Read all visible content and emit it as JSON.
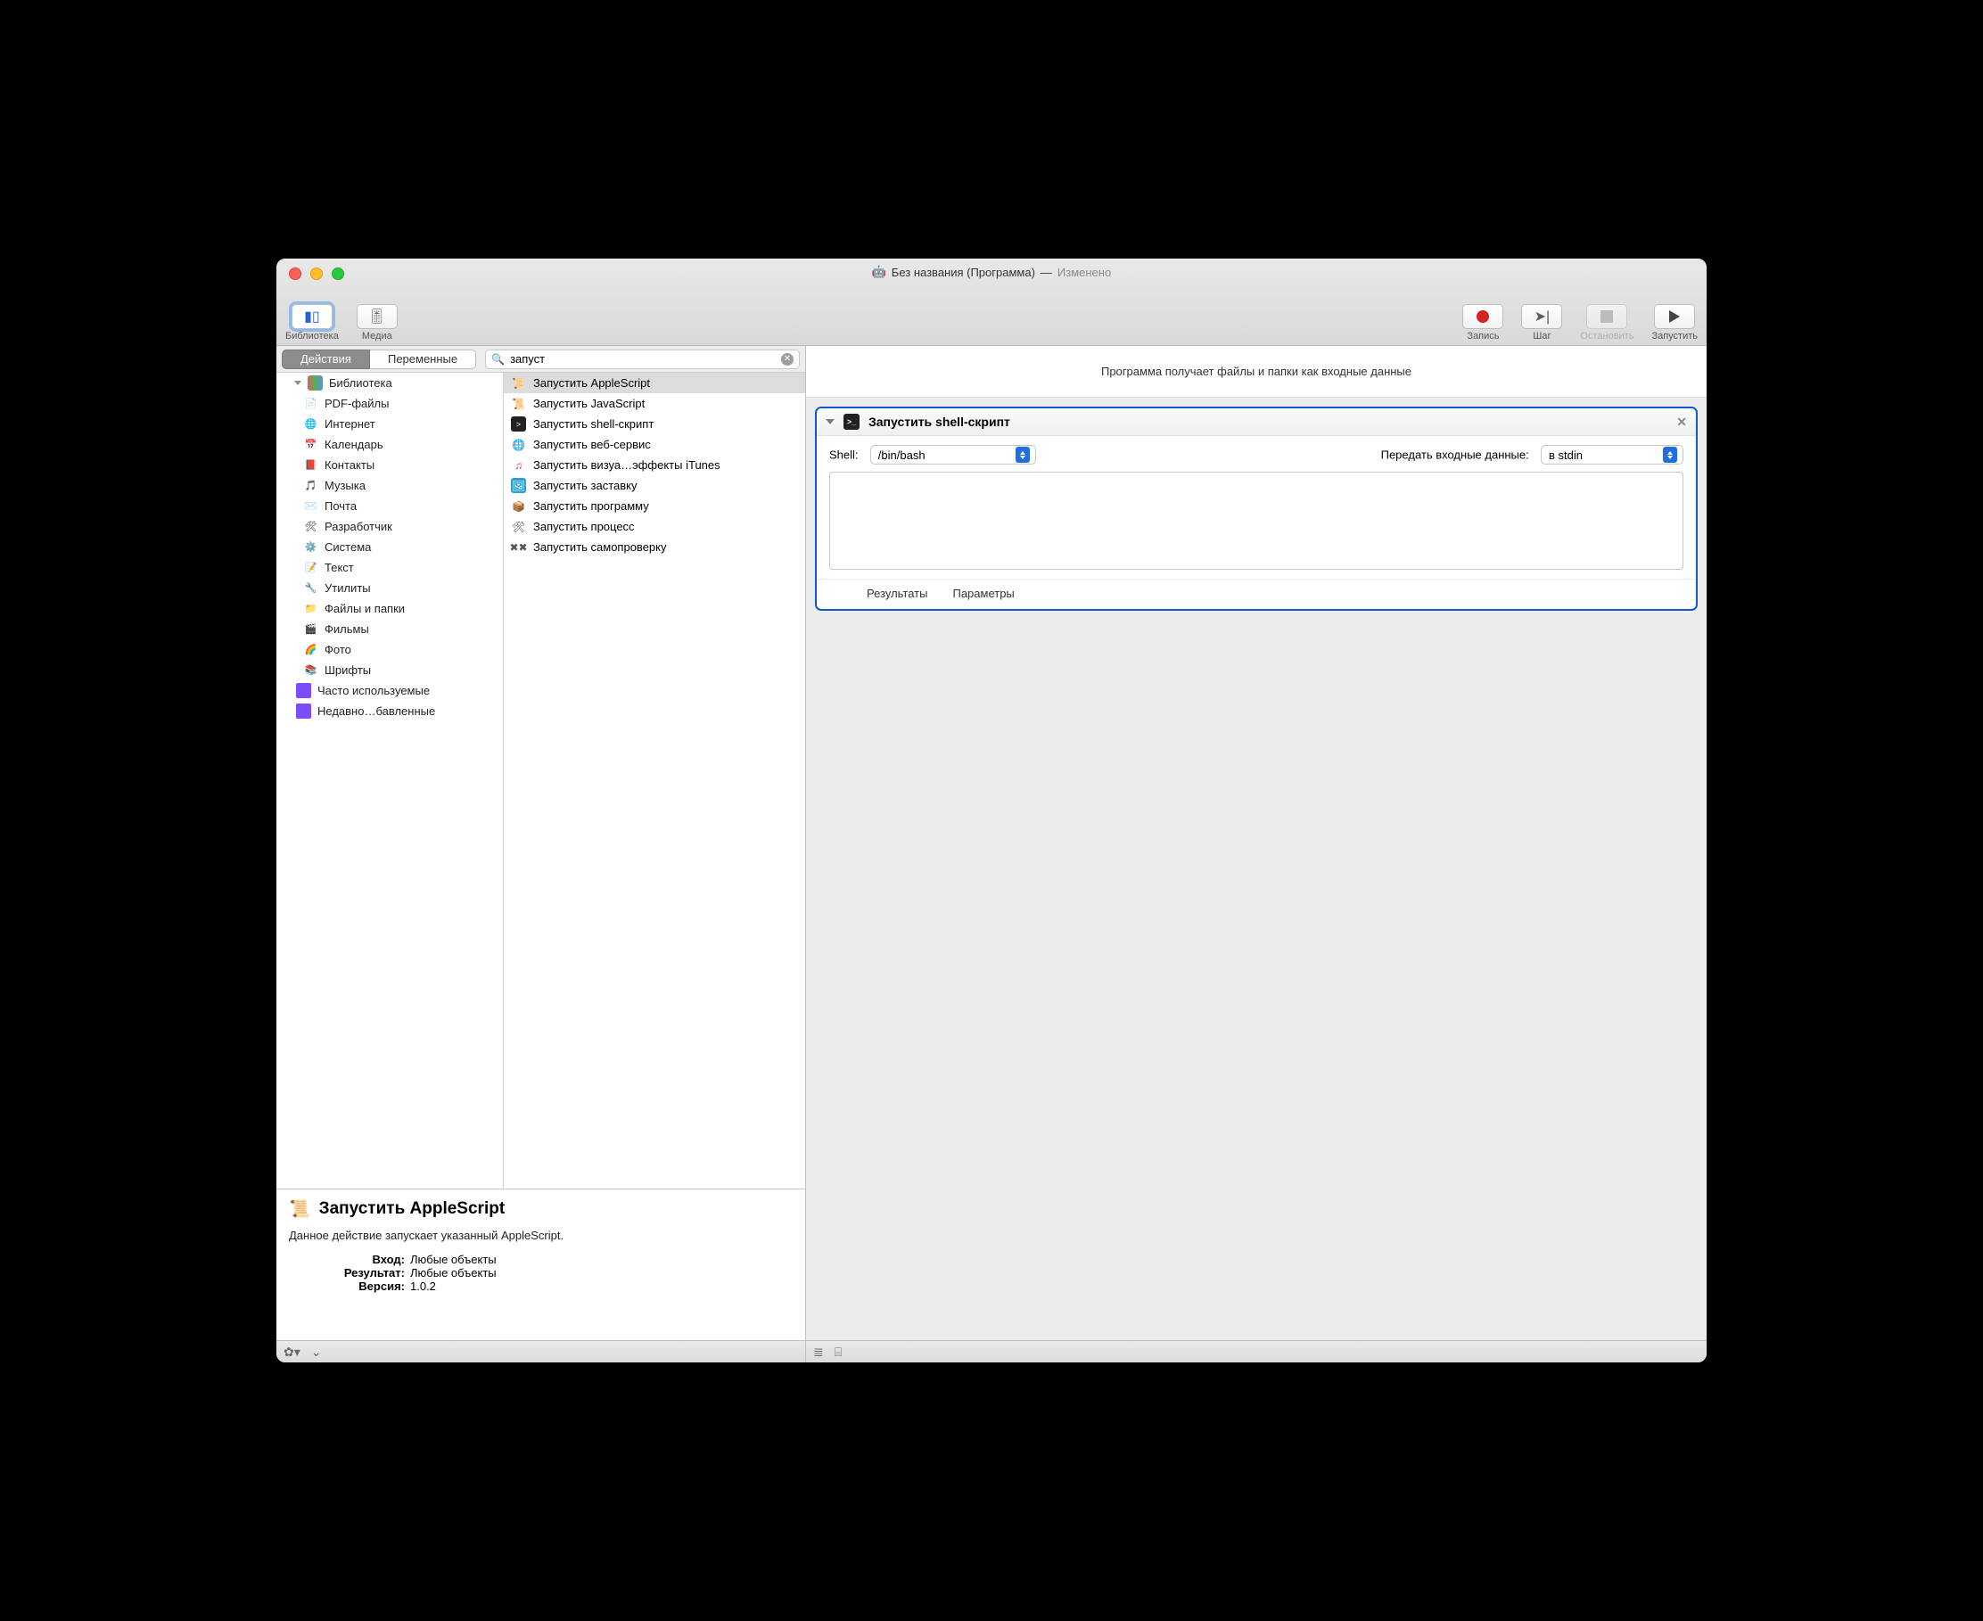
{
  "title": {
    "name": "Без названия (Программа)",
    "status": "Изменено"
  },
  "toolbar": {
    "left": [
      {
        "key": "library",
        "label": "Библиотека",
        "active": true
      },
      {
        "key": "media",
        "label": "Медиа"
      }
    ],
    "right": [
      {
        "key": "record",
        "label": "Запись"
      },
      {
        "key": "step",
        "label": "Шаг"
      },
      {
        "key": "stop",
        "label": "Остановить",
        "disabled": true
      },
      {
        "key": "run",
        "label": "Запустить"
      }
    ]
  },
  "segmented": {
    "actions": "Действия",
    "variables": "Переменные"
  },
  "search": {
    "value": "запуст"
  },
  "library_root": "Библиотека",
  "library": [
    {
      "label": "PDF-файлы",
      "icon": "📄"
    },
    {
      "label": "Интернет",
      "icon": "🌐"
    },
    {
      "label": "Календарь",
      "icon": "📅"
    },
    {
      "label": "Контакты",
      "icon": "📕"
    },
    {
      "label": "Музыка",
      "icon": "🎵"
    },
    {
      "label": "Почта",
      "icon": "✉️"
    },
    {
      "label": "Разработчик",
      "icon": "🛠"
    },
    {
      "label": "Система",
      "icon": "⚙️"
    },
    {
      "label": "Текст",
      "icon": "📝"
    },
    {
      "label": "Утилиты",
      "icon": "🔧"
    },
    {
      "label": "Файлы и папки",
      "icon": "📁"
    },
    {
      "label": "Фильмы",
      "icon": "🎬"
    },
    {
      "label": "Фото",
      "icon": "🌈"
    },
    {
      "label": "Шрифты",
      "icon": "📚"
    }
  ],
  "library_smart": [
    {
      "label": "Часто используемые"
    },
    {
      "label": "Недавно…бавленные"
    }
  ],
  "actions_list": [
    {
      "label": "Запустить AppleScript",
      "icon": "script",
      "selected": true
    },
    {
      "label": "Запустить JavaScript",
      "icon": "script"
    },
    {
      "label": "Запустить shell-скрипт",
      "icon": "term"
    },
    {
      "label": "Запустить веб-сервис",
      "icon": "globe"
    },
    {
      "label": "Запустить визуа…эффекты iTunes",
      "icon": "itunes"
    },
    {
      "label": "Запустить заставку",
      "icon": "pic"
    },
    {
      "label": "Запустить программу",
      "icon": "app"
    },
    {
      "label": "Запустить процесс",
      "icon": "tools"
    },
    {
      "label": "Запустить самопроверку",
      "icon": "gear"
    }
  ],
  "description": {
    "title": "Запустить AppleScript",
    "subtitle": "Данное действие запускает указанный AppleScript.",
    "rows": [
      {
        "k": "Вход:",
        "v": "Любые объекты"
      },
      {
        "k": "Результат:",
        "v": "Любые объекты"
      },
      {
        "k": "Версия:",
        "v": "1.0.2"
      }
    ]
  },
  "canvas": {
    "header_hint": "Программа получает файлы и папки как входные данные",
    "action": {
      "title": "Запустить shell-скрипт",
      "shell_label": "Shell:",
      "shell_value": "/bin/bash",
      "pass_label": "Передать входные данные:",
      "pass_value": "в stdin",
      "footer": {
        "results": "Результаты",
        "options": "Параметры"
      },
      "script": ""
    }
  }
}
